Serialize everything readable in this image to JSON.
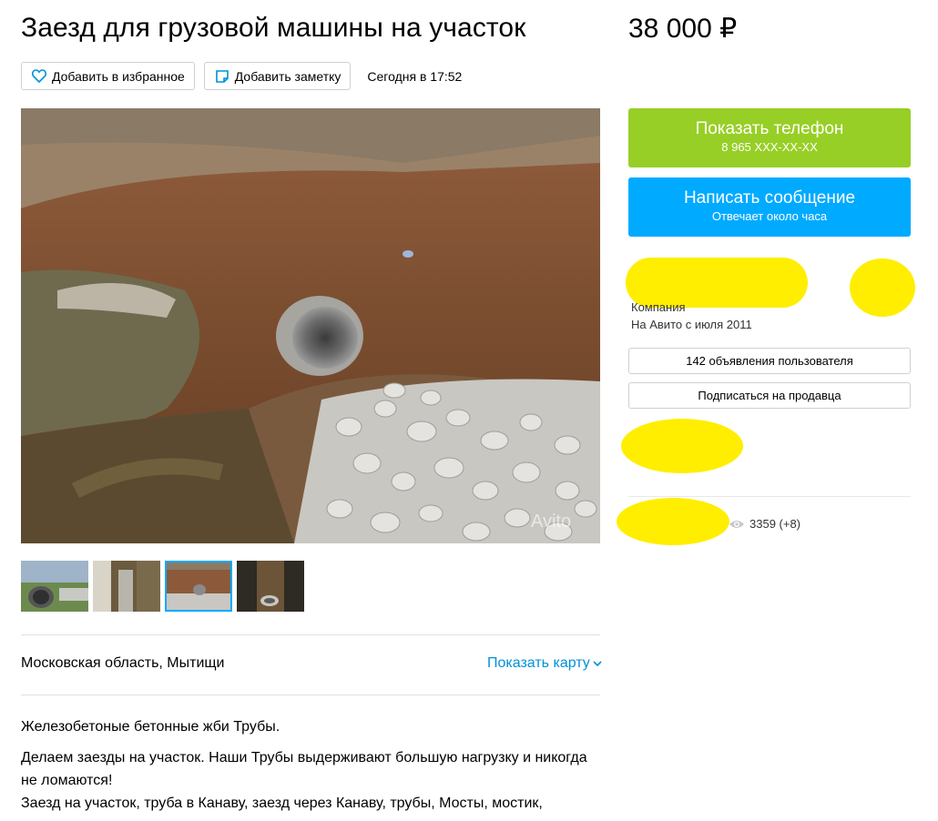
{
  "listing": {
    "title": "Заезд для грузовой машины на участок",
    "price": "38 000 ₽",
    "add_favorite": "Добавить в избранное",
    "add_note": "Добавить заметку",
    "date": "Сегодня в 17:52"
  },
  "location": {
    "address": "Московская область, Мытищи",
    "show_map": "Показать карту"
  },
  "description": {
    "p1": "Железобетоные бетонные жби Трубы.",
    "p2": "Делаем заезды на участок. Наши Трубы выдерживают большую нагрузку и никогда не ломаются!",
    "p3": "Заезд на участок, труба в Канаву, заезд через Канаву, трубы, Мосты, мостик,"
  },
  "seller": {
    "show_phone": "Показать телефон",
    "phone_masked": "8 965 XXX-XX-XX",
    "write_message": "Написать сообщение",
    "response_time": "Отвечает около часа",
    "type": "Компания",
    "since": "На Авито с июля 2011",
    "listings": "142 объявления пользователя",
    "subscribe": "Подписаться на продавца"
  },
  "stats": {
    "views": "3359 (+8)"
  },
  "colors": {
    "phone_button": "#97cf26",
    "message_button": "#00aaff",
    "link": "#0091d9",
    "redaction": "#ffee00"
  }
}
